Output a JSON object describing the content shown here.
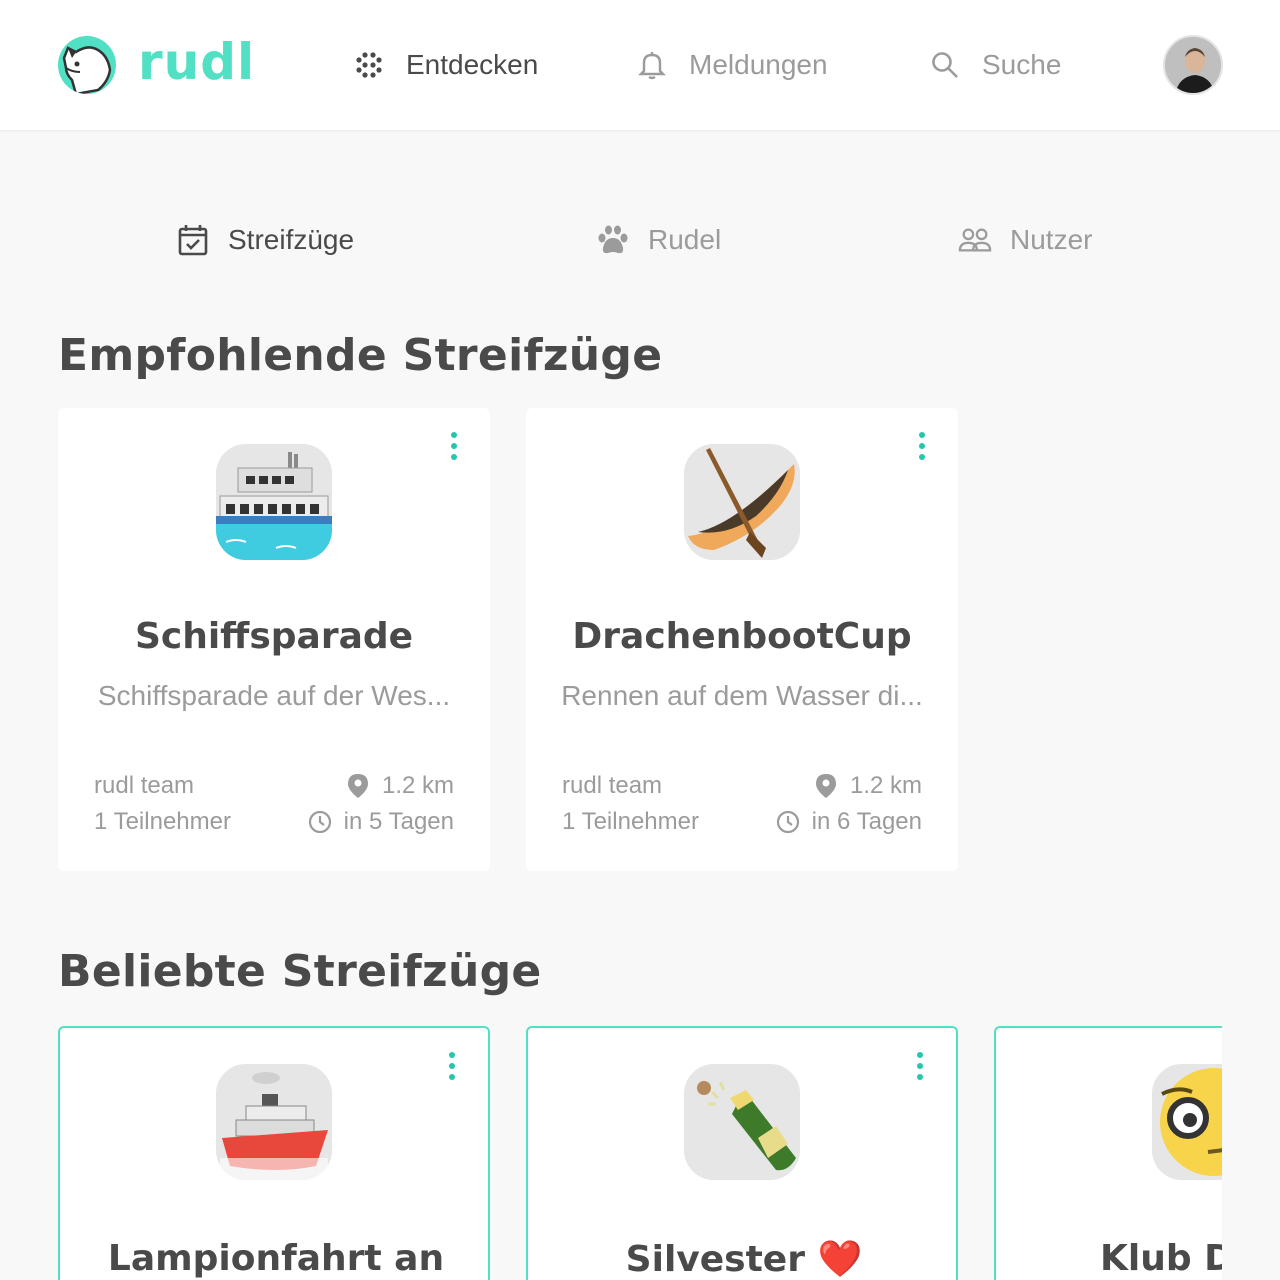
{
  "app": {
    "brand": "rudl",
    "accent": "#52e0c4"
  },
  "nav": {
    "items": [
      {
        "label": "Entdecken",
        "icon": "dots-grid-icon",
        "active": true
      },
      {
        "label": "Meldungen",
        "icon": "bell-icon",
        "active": false
      },
      {
        "label": "Suche",
        "icon": "search-icon",
        "active": false
      }
    ]
  },
  "tabs": [
    {
      "label": "Streifzüge",
      "icon": "calendar-check-icon",
      "active": true
    },
    {
      "label": "Rudel",
      "icon": "paw-icon",
      "active": false
    },
    {
      "label": "Nutzer",
      "icon": "users-icon",
      "active": false
    }
  ],
  "sections": {
    "recommended": {
      "title": "Empfohlende Streifzüge",
      "cards": [
        {
          "icon": "ferry-icon",
          "title": "Schiffsparade",
          "description": "Schiffsparade auf der Wes...",
          "author": "rudl team",
          "participants": "1 Teilnehmer",
          "distance": "1.2 km",
          "when": "in 5 Tagen"
        },
        {
          "icon": "canoe-icon",
          "title": "DrachenbootCup",
          "description": "Rennen auf dem Wasser di...",
          "author": "rudl team",
          "participants": "1 Teilnehmer",
          "distance": "1.2 km",
          "when": "in 6 Tagen"
        }
      ]
    },
    "popular": {
      "title": "Beliebte Streifzüge",
      "cards": [
        {
          "icon": "ship-icon",
          "title": "Lampionfahrt an"
        },
        {
          "icon": "champagne-icon",
          "title": "Silvester ❤️"
        },
        {
          "icon": "nerd-face-icon",
          "title": "Klub D"
        }
      ]
    }
  }
}
